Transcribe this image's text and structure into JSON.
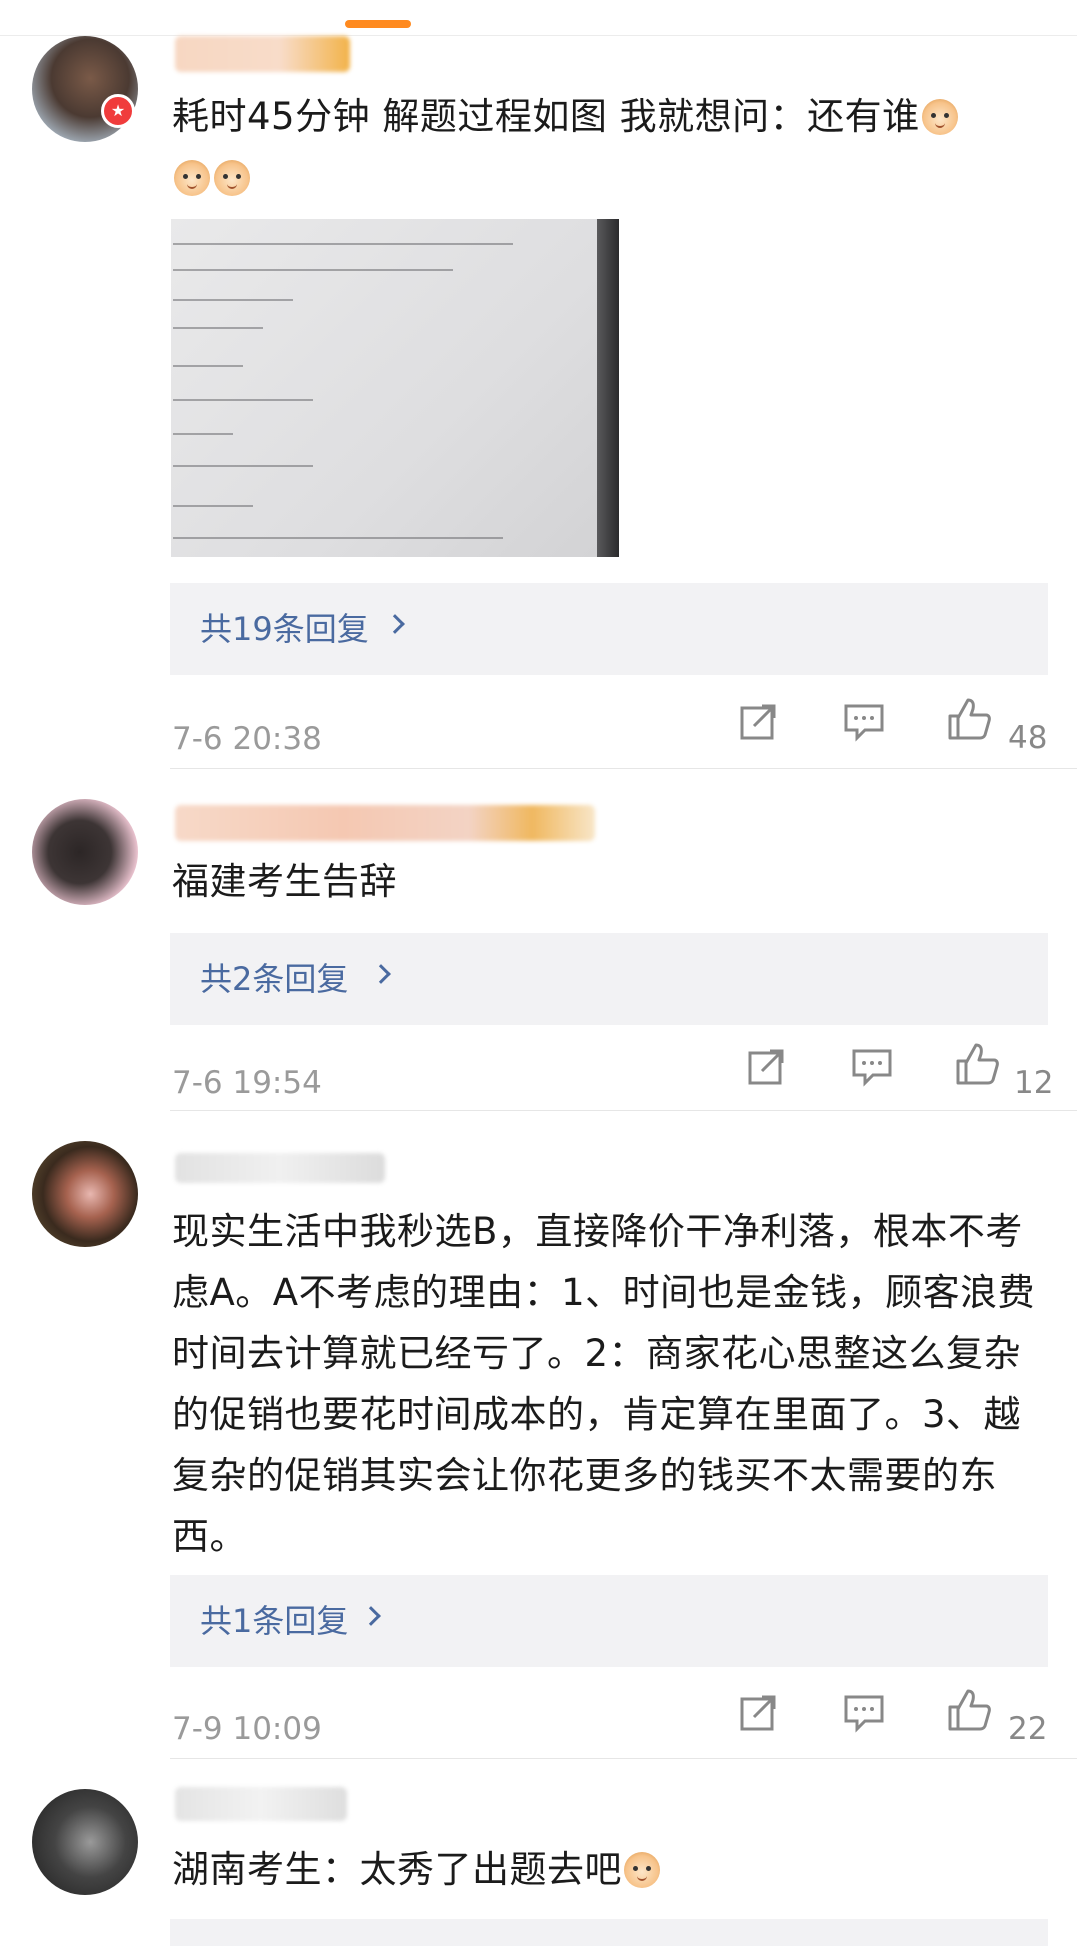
{
  "comments": [
    {
      "text": "耗时45分钟 解题过程如图 我就想问：还有谁",
      "replies": "共19条回复",
      "time": "7-6 20:38",
      "likes": "48",
      "emoji_icon": "cat-face-emoji"
    },
    {
      "text": "福建考生告辞",
      "replies": "共2条回复",
      "time": "7-6 19:54",
      "likes": "12"
    },
    {
      "text": "现实生活中我秒选B，直接降价干净利落，根本不考虑A。A不考虑的理由：1、时间也是金钱，顾客浪费时间去计算就已经亏了。2：商家花心思整这么复杂的促销也要花时间成本的，肯定算在里面了。3、越复杂的促销其实会让你花更多的钱买不太需要的东西。",
      "replies": "共1条回复",
      "time": "7-9 10:09",
      "likes": "22"
    },
    {
      "text": "湖南考生：太秀了出题去吧",
      "emoji_icon": "doge-emoji"
    }
  ],
  "colors": {
    "reply_text": "#4a6aa0",
    "reply_bg": "#f2f2f4",
    "meta": "#9a9a9a",
    "verified_badge": "#f03c3c",
    "accent": "#ff8a1f"
  },
  "icons": [
    "share-icon",
    "comment-icon",
    "like-icon"
  ]
}
